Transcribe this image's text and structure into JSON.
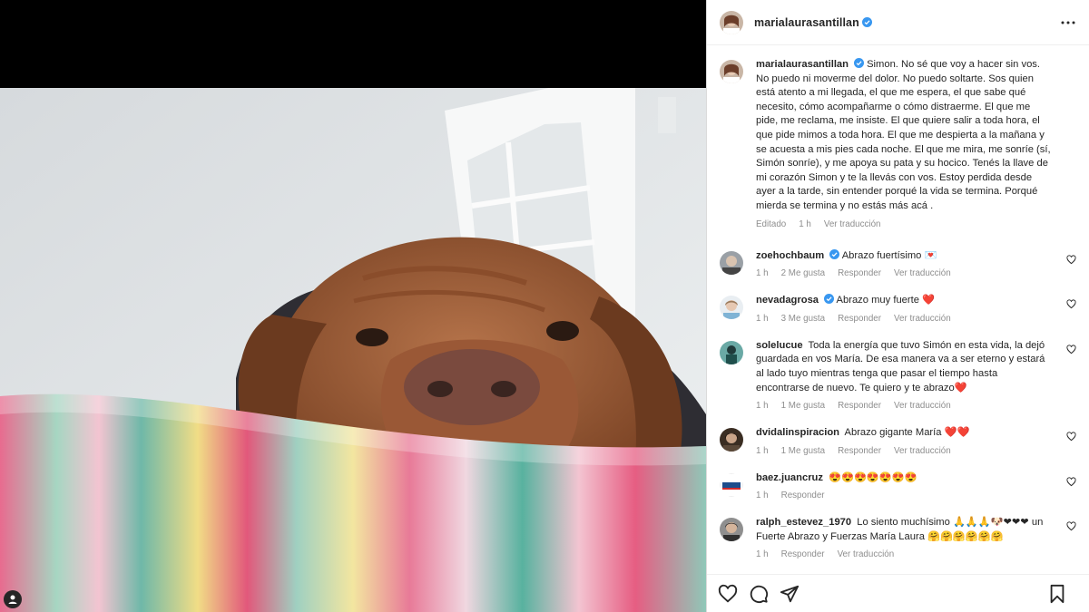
{
  "post": {
    "username": "marialaurasantillan",
    "caption": "Simon. No sé que voy a hacer sin vos. No puedo ni moverme del dolor. No puedo soltarte. Sos quien está atento a mi llegada, el que me espera, el que sabe qué necesito, cómo acompañarme o cómo distraerme. El que me pide, me reclama, me insiste. El que quiere salir a toda hora, el que pide mimos a toda hora. El que me despierta a la mañana y se acuesta a mis pies cada noche. El que me mira, me sonríe (sí, Simón sonríe), y me apoya su pata y su hocico. Tenés la llave de mi corazón Simon y te la llevás con vos. Estoy perdida desde ayer a la tarde, sin entender porqué la vida se termina. Porqué mierda se termina y no estás más acá .",
    "caption_meta": {
      "edited": "Editado",
      "time": "1 h",
      "translate": "Ver traducción"
    }
  },
  "comments": [
    {
      "username": "zoehochbaum",
      "verified": true,
      "text": "Abrazo fuertísimo",
      "emoji": "💌",
      "time": "1 h",
      "likes": "2 Me gusta",
      "reply": "Responder",
      "translate": "Ver traducción"
    },
    {
      "username": "nevadagrosa",
      "verified": true,
      "text": "Abrazo muy fuerte",
      "emoji": "❤️",
      "time": "1 h",
      "likes": "3 Me gusta",
      "reply": "Responder",
      "translate": "Ver traducción"
    },
    {
      "username": "solelucue",
      "verified": false,
      "text": "Toda la energía que tuvo Simón en esta vida, la dejó guardada en vos María. De esa manera va a ser eterno y estará al lado tuyo mientras tenga que pasar el tiempo hasta encontrarse de nuevo. Te quiero y te abrazo",
      "emoji": "❤️",
      "time": "1 h",
      "likes": "1 Me gusta",
      "reply": "Responder",
      "translate": "Ver traducción"
    },
    {
      "username": "dvidalinspiracion",
      "verified": false,
      "text": "Abrazo gigante María",
      "emoji": "❤️❤️",
      "time": "1 h",
      "likes": "1 Me gusta",
      "reply": "Responder",
      "translate": "Ver traducción"
    },
    {
      "username": "baez.juancruz",
      "verified": false,
      "text": "",
      "emoji": "😍😍😍😍😍😍😍",
      "time": "1 h",
      "likes": "",
      "reply": "Responder",
      "translate": ""
    },
    {
      "username": "ralph_estevez_1970",
      "verified": false,
      "text": "Lo siento muchísimo 🙏🙏🙏🐶❤❤❤ un Fuerte Abrazo y Fuerzas María Laura",
      "emoji": "🤗🤗🤗🤗🤗🤗",
      "time": "1 h",
      "likes": "",
      "reply": "Responder",
      "translate": "Ver traducción"
    }
  ],
  "icons": {
    "like": "heart-icon",
    "comment": "comment-icon",
    "share": "share-icon",
    "save": "bookmark-icon",
    "more": "more-icon"
  },
  "colors": {
    "verified": "#3897f0",
    "heart": "#ed4956",
    "meta": "#8e8e8e"
  }
}
